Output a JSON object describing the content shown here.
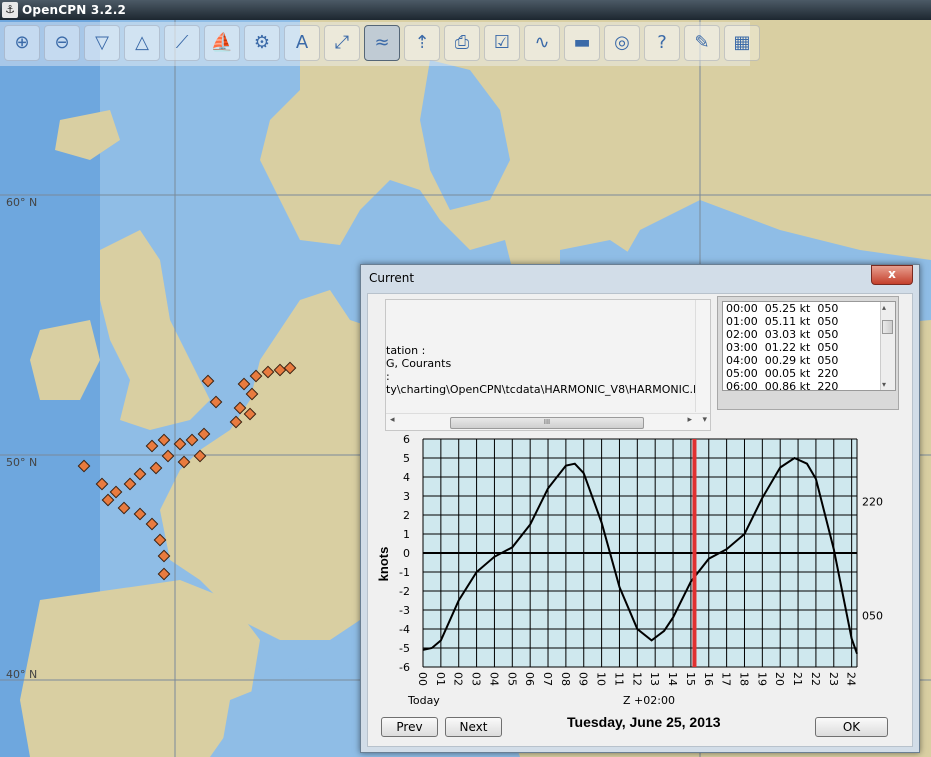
{
  "window": {
    "title": "OpenCPN 3.2.2"
  },
  "toolbar": {
    "buttons": [
      {
        "name": "zoom-in-icon",
        "glyph": "⊕"
      },
      {
        "name": "zoom-out-icon",
        "glyph": "⊖"
      },
      {
        "name": "scale-down-icon",
        "glyph": "▽"
      },
      {
        "name": "scale-up-icon",
        "glyph": "△"
      },
      {
        "name": "route-icon",
        "glyph": "⟋"
      },
      {
        "name": "ship-icon",
        "glyph": "⛵"
      },
      {
        "name": "settings-icon",
        "glyph": "⚙"
      },
      {
        "name": "text-icon",
        "glyph": "A"
      },
      {
        "name": "measure-icon",
        "glyph": "⤢"
      },
      {
        "name": "tide-icon",
        "glyph": "≈"
      },
      {
        "name": "current-icon",
        "glyph": "⇡"
      },
      {
        "name": "print-icon",
        "glyph": "⎙"
      },
      {
        "name": "route-manager-icon",
        "glyph": "☑"
      },
      {
        "name": "track-icon",
        "glyph": "∿"
      },
      {
        "name": "color-scheme-icon",
        "glyph": "▬"
      },
      {
        "name": "mob-icon",
        "glyph": "◎"
      },
      {
        "name": "help-icon",
        "glyph": "?"
      },
      {
        "name": "plugin-icon",
        "glyph": "✎"
      },
      {
        "name": "chart-icon",
        "glyph": "▦"
      }
    ]
  },
  "map": {
    "lat_labels": [
      "60° N",
      "50° N",
      "40° N"
    ]
  },
  "dialog": {
    "title": "Current",
    "close_glyph": "x",
    "info_lines": [
      "tation :",
      "G, Courants",
      ":",
      "ty\\charting\\OpenCPN\\tcdata\\HARMONIC_V8\\HARMONIC.IDX"
    ],
    "scroll_thumb": "III",
    "list_items": [
      "00:00  05.25 kt  050",
      "01:00  05.11 kt  050",
      "02:00  03.03 kt  050",
      "03:00  01.22 kt  050",
      "04:00  00.29 kt  050",
      "05:00  00.05 kt  220",
      "06:00  00.86 kt  220"
    ],
    "today_label": "Today",
    "tz_label": "Z +02:00",
    "date": "Tuesday, June 25, 2013",
    "prev_label": "Prev",
    "next_label": "Next",
    "ok_label": "OK"
  },
  "chart_data": {
    "type": "line",
    "ylabel": "knots",
    "ylim": [
      -6,
      6
    ],
    "yticks": [
      6,
      5,
      4,
      3,
      2,
      1,
      0,
      -1,
      -2,
      -3,
      -4,
      -5,
      -6
    ],
    "x_tick_labels": [
      "00",
      "01",
      "02",
      "03",
      "04",
      "05",
      "06",
      "07",
      "08",
      "09",
      "10",
      "11",
      "12",
      "13",
      "14",
      "15",
      "16",
      "17",
      "18",
      "19",
      "20",
      "21",
      "22",
      "23",
      "24"
    ],
    "right_labels": [
      {
        "text": "220",
        "y": 2.7
      },
      {
        "text": "050",
        "y": -3.3
      }
    ],
    "current_hour": 15.2,
    "series": [
      {
        "x": [
          0,
          0.5,
          1,
          2,
          3,
          4,
          5,
          6,
          7,
          8,
          8.5,
          9,
          10,
          11,
          12,
          12.8,
          13.5,
          14,
          15,
          16,
          17,
          18,
          19,
          20,
          20.8,
          21.5,
          22,
          23,
          24,
          24.3
        ],
        "values": [
          -5.1,
          -5.0,
          -4.6,
          -2.5,
          -1.0,
          -0.2,
          0.3,
          1.5,
          3.4,
          4.6,
          4.7,
          4.2,
          1.6,
          -1.8,
          -4.0,
          -4.6,
          -4.1,
          -3.4,
          -1.5,
          -0.3,
          0.2,
          1.0,
          2.9,
          4.5,
          5.0,
          4.7,
          3.9,
          0.2,
          -4.5,
          -5.3
        ]
      }
    ]
  }
}
